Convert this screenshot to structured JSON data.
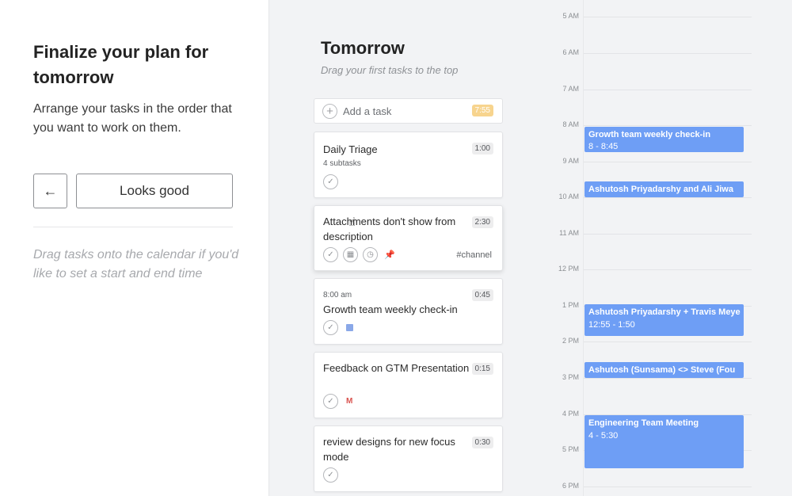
{
  "left": {
    "heading": "Finalize your plan for tomorrow",
    "subheading": "Arrange your tasks in the order that you want to work on them.",
    "back_glyph": "←",
    "confirm_label": "Looks good",
    "hint": "Drag tasks onto the calendar if you'd like to set a start and end time"
  },
  "column": {
    "title": "Tomorrow",
    "subtitle": "Drag your first tasks to the top",
    "add_task": {
      "label": "Add a task",
      "total_time": "7:55"
    },
    "tasks": [
      {
        "title": "Daily Triage",
        "duration": "1:00",
        "meta": "4 subtasks"
      },
      {
        "title": "Attachments don't show from description",
        "duration": "2:30",
        "channel": "#channel"
      },
      {
        "time": "8:00 am",
        "title": "Growth team weekly check-in",
        "duration": "0:45"
      },
      {
        "title": "Feedback on GTM Presentation",
        "duration": "0:15",
        "source_icon": "M"
      },
      {
        "title": "review designs for new focus mode",
        "duration": "0:30"
      }
    ]
  },
  "calendar": {
    "hours": [
      "5 AM",
      "6 AM",
      "7 AM",
      "8 AM",
      "9 AM",
      "10 AM",
      "11 AM",
      "12 PM",
      "1 PM",
      "2 PM",
      "3 PM",
      "4 PM",
      "5 PM",
      "6 PM"
    ],
    "events": [
      {
        "title": "Growth team weekly check-in",
        "time": "8 - 8:45"
      },
      {
        "title": "Ashutosh Priyadarshy and Ali Jiwa",
        "time": ""
      },
      {
        "title": "Ashutosh Priyadarshy + Travis Meye",
        "time": "12:55 - 1:50"
      },
      {
        "title": "Ashutosh (Sunsama) <> Steve (Fou",
        "time": ""
      },
      {
        "title": "Engineering Team Meeting",
        "time": "4 - 5:30"
      }
    ],
    "event_color": "#6e9ef5"
  }
}
